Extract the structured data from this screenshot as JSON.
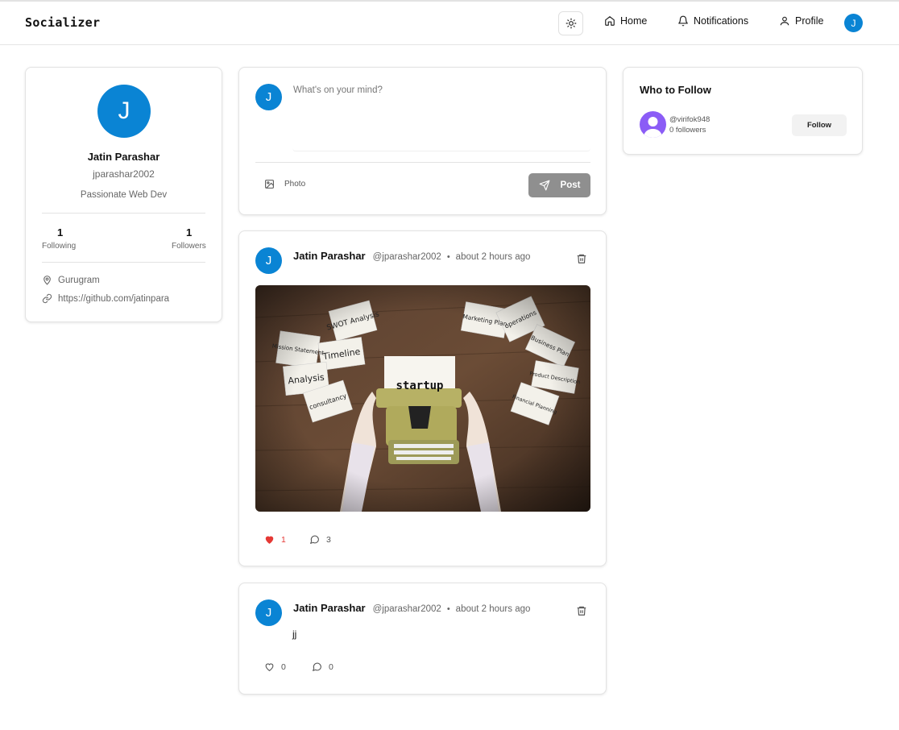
{
  "app": {
    "brand": "Socializer"
  },
  "nav": {
    "theme_icon": "sun-icon",
    "home_label": "Home",
    "notifications_label": "Notifications",
    "profile_label": "Profile",
    "avatar_initial": "J"
  },
  "profile": {
    "avatar_initial": "J",
    "name": "Jatin Parashar",
    "handle": "jparashar2002",
    "bio": "Passionate Web Dev",
    "following_count": "1",
    "following_label": "Following",
    "followers_count": "1",
    "followers_label": "Followers",
    "location": "Gurugram",
    "website": "https://github.com/jatinpara"
  },
  "composer": {
    "avatar_initial": "J",
    "placeholder": "What's on your mind?",
    "photo_label": "Photo",
    "post_label": "Post"
  },
  "posts": [
    {
      "avatar_initial": "J",
      "author": "Jatin Parashar",
      "handle": "@jparashar2002",
      "separator": "•",
      "time": "about 2 hours ago",
      "has_image": true,
      "likes": "1",
      "liked": true,
      "comments": "3"
    },
    {
      "avatar_initial": "J",
      "author": "Jatin Parashar",
      "handle": "@jparashar2002",
      "separator": "•",
      "time": "about 2 hours ago",
      "text": "jj",
      "likes": "0",
      "liked": false,
      "comments": "0"
    }
  ],
  "image_labels": {
    "paper": "startup",
    "notes": [
      "SWOT Analysis",
      "Mission Statement",
      "Timeline",
      "Analysis",
      "consultancy",
      "Marketing Plan",
      "operations",
      "Business Plan",
      "Product Description",
      "Financial Planning"
    ]
  },
  "who_to_follow": {
    "title": "Who to Follow",
    "users": [
      {
        "handle": "@virifok948",
        "followers": "0 followers",
        "follow_label": "Follow"
      }
    ]
  },
  "colors": {
    "accent": "#0a84d4",
    "like_red": "#e53935",
    "post_button": "#8f8f8f",
    "follow_avatar": "#8b5cf6"
  }
}
